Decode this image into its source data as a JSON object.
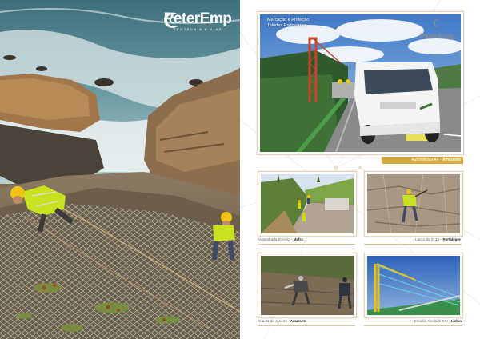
{
  "brand": {
    "name": "PeterEmp",
    "tagline": "GEOTECNIA E VIAS"
  },
  "cover_overlay": {
    "title": "Marcação e Proteção Taludes Rodoviários",
    "watermark": "PeterEmp"
  },
  "captions": {
    "main": {
      "place": "Autoestrada A4 - ",
      "city": "Amarante"
    },
    "photo1": {
      "place": "Autoestrada Ericeira - ",
      "city": "Mafra"
    },
    "photo2": {
      "place": "Lanço do IC 13 - ",
      "city": "Portalegre"
    },
    "photo3": {
      "place": "Rua 31 de Janeiro - ",
      "city": "Amarante"
    },
    "photo4": {
      "place": "Estádio Alvalade XXI - ",
      "city": "Lisboa"
    }
  },
  "colors": {
    "gold": "#d7a93b",
    "frame": "#e3d7b8",
    "hi_vis_yellow": "#c8e21f",
    "helmet": "#f2c313"
  },
  "icons": {
    "logo": "swirl-logo-icon"
  }
}
